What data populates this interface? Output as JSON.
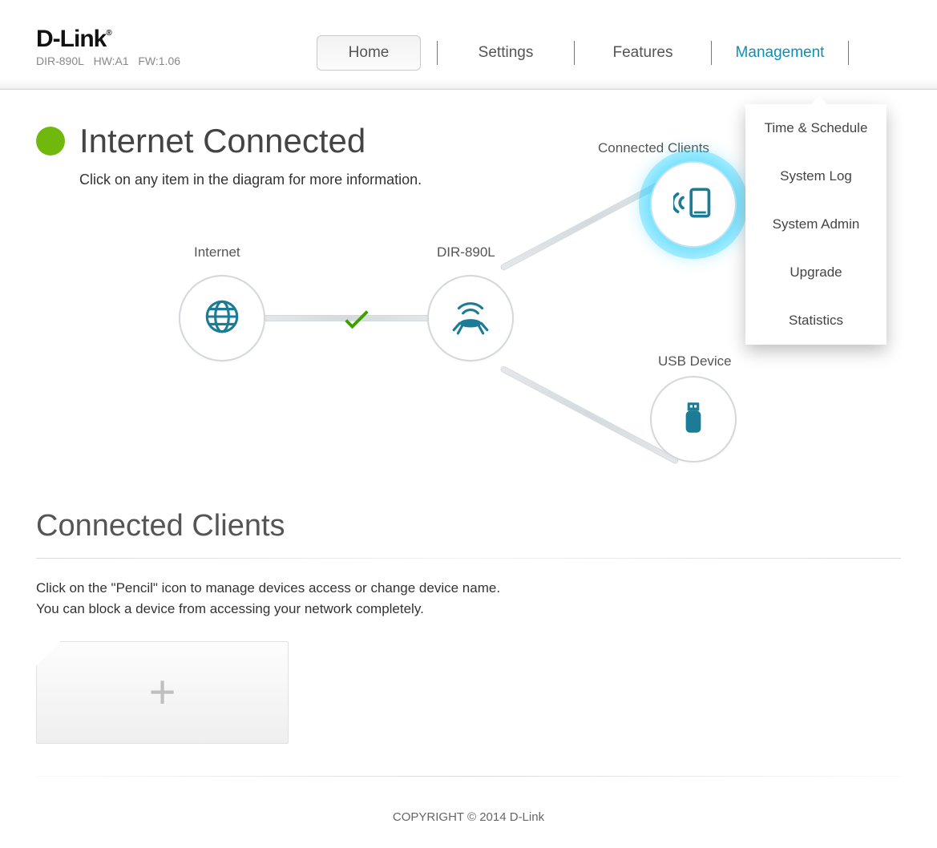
{
  "brand": {
    "logo_text": "D-Link",
    "model": "DIR-890L",
    "hw": "HW:A1",
    "fw": "FW:1.06"
  },
  "nav": {
    "home": "Home",
    "settings": "Settings",
    "features": "Features",
    "management": "Management"
  },
  "dropdown": {
    "items": [
      "Time & Schedule",
      "System Log",
      "System Admin",
      "Upgrade",
      "Statistics"
    ]
  },
  "status": {
    "title": "Internet Connected",
    "subtitle": "Click on any item in the diagram for more information."
  },
  "diagram": {
    "internet_label": "Internet",
    "router_label": "DIR-890L",
    "clients_label": "Connected Clients",
    "usb_label": "USB Device"
  },
  "clients_section": {
    "title": "Connected Clients",
    "line1": "Click on the \"Pencil\" icon to manage devices access or change device name.",
    "line2": "You can block a device from accessing your network completely."
  },
  "footer": "COPYRIGHT © 2014 D-Link"
}
